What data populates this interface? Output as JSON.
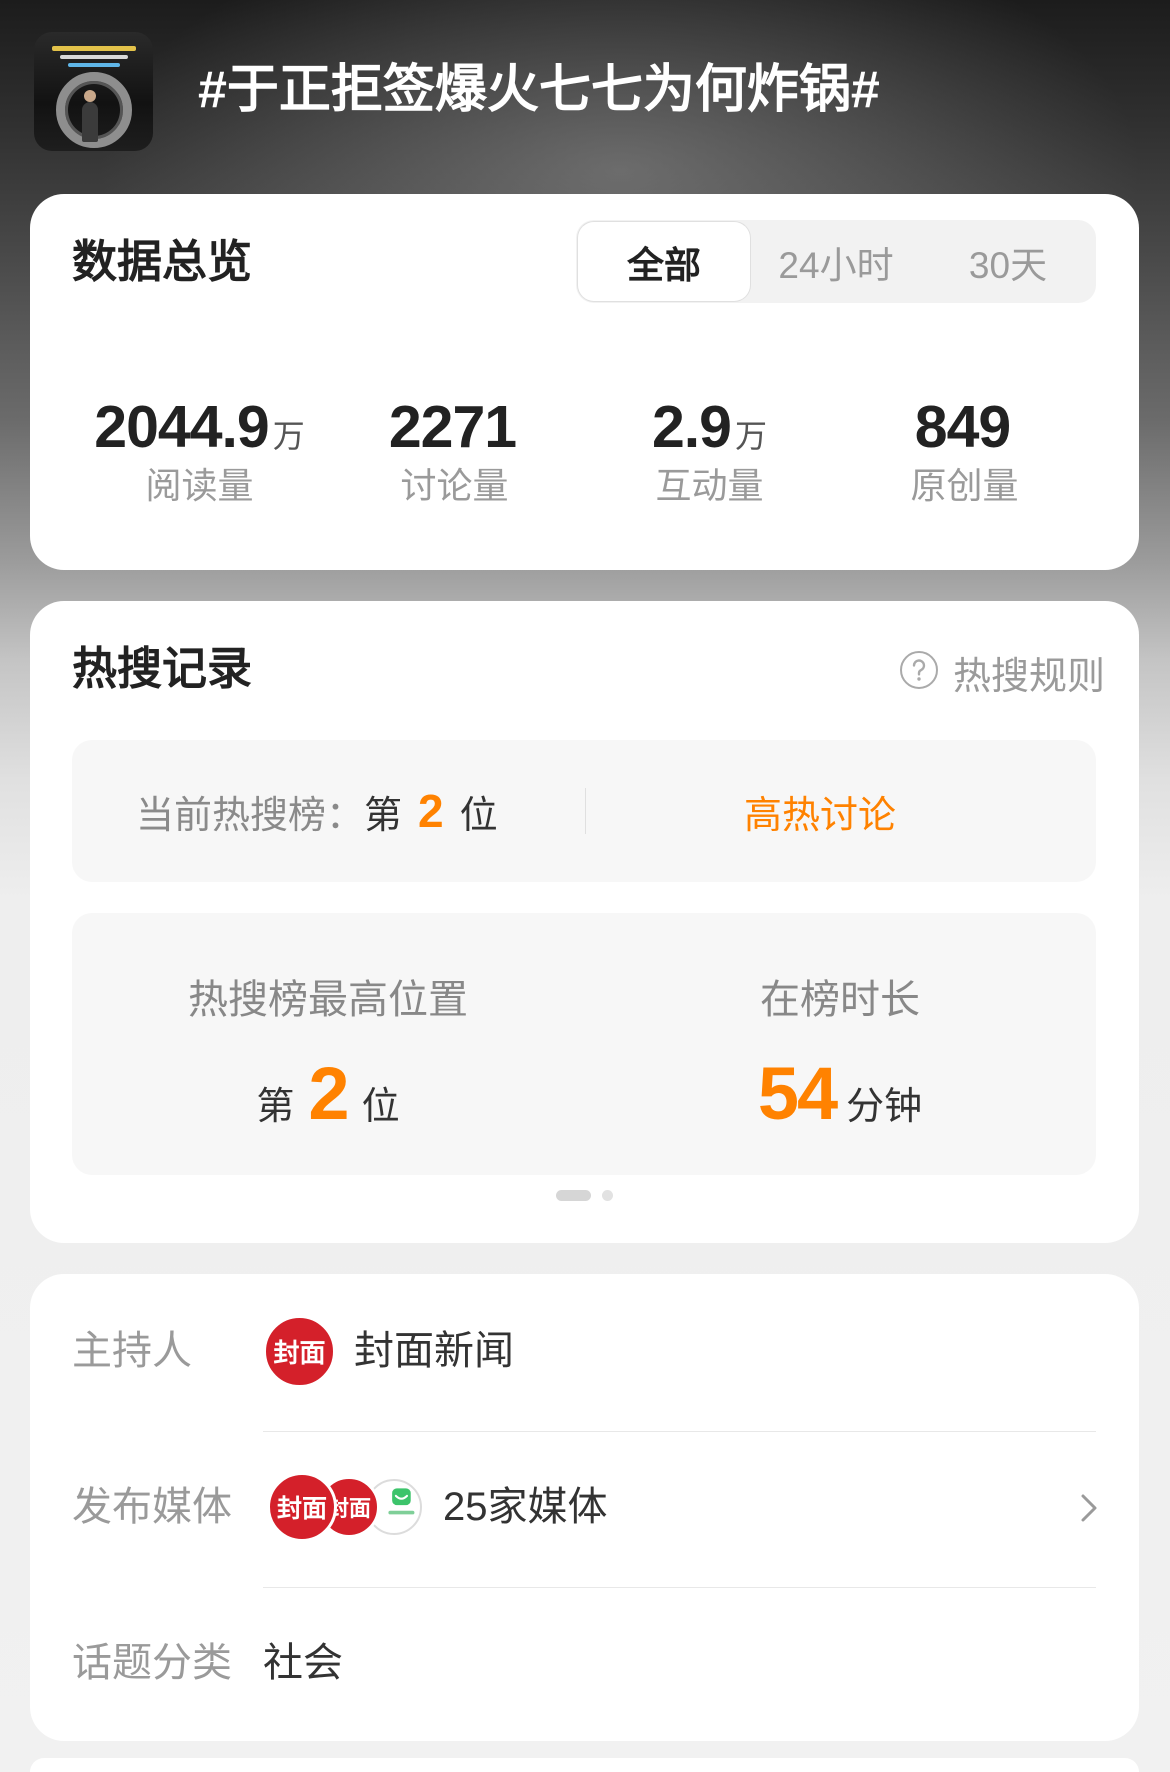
{
  "header": {
    "title": "#于正拒签爆火七七为何炸锅#"
  },
  "overview": {
    "title": "数据总览",
    "tabs": [
      {
        "label": "全部",
        "selected": true
      },
      {
        "label": "24小时",
        "selected": false
      },
      {
        "label": "30天",
        "selected": false
      }
    ],
    "stats": [
      {
        "value": "2044.9",
        "unit": "万",
        "label": "阅读量"
      },
      {
        "value": "2271",
        "unit": "",
        "label": "讨论量"
      },
      {
        "value": "2.9",
        "unit": "万",
        "label": "互动量"
      },
      {
        "value": "849",
        "unit": "",
        "label": "原创量"
      }
    ]
  },
  "hot_search": {
    "title": "热搜记录",
    "rules_label": "热搜规则",
    "current": {
      "label": "当前热搜榜：",
      "prefix": "第",
      "rank": "2",
      "suffix": "位",
      "tag": "高热讨论"
    },
    "peak": {
      "label": "热搜榜最高位置",
      "prefix": "第",
      "rank": "2",
      "suffix": "位"
    },
    "duration": {
      "label": "在榜时长",
      "value": "54",
      "unit": "分钟"
    },
    "pager": {
      "pages": 2,
      "current": 1
    }
  },
  "info": {
    "host": {
      "label": "主持人",
      "logo_text": "封面",
      "name": "封面新闻"
    },
    "media": {
      "label": "发布媒体",
      "logo_texts": [
        "封面",
        "封面"
      ],
      "count_text": "25家媒体"
    },
    "category": {
      "label": "话题分类",
      "value": "社会"
    }
  },
  "icons": [
    "question-circle-icon",
    "chevron-right-icon"
  ],
  "colors": {
    "accent": "#ff8200",
    "logo_red": "#d4202a"
  }
}
